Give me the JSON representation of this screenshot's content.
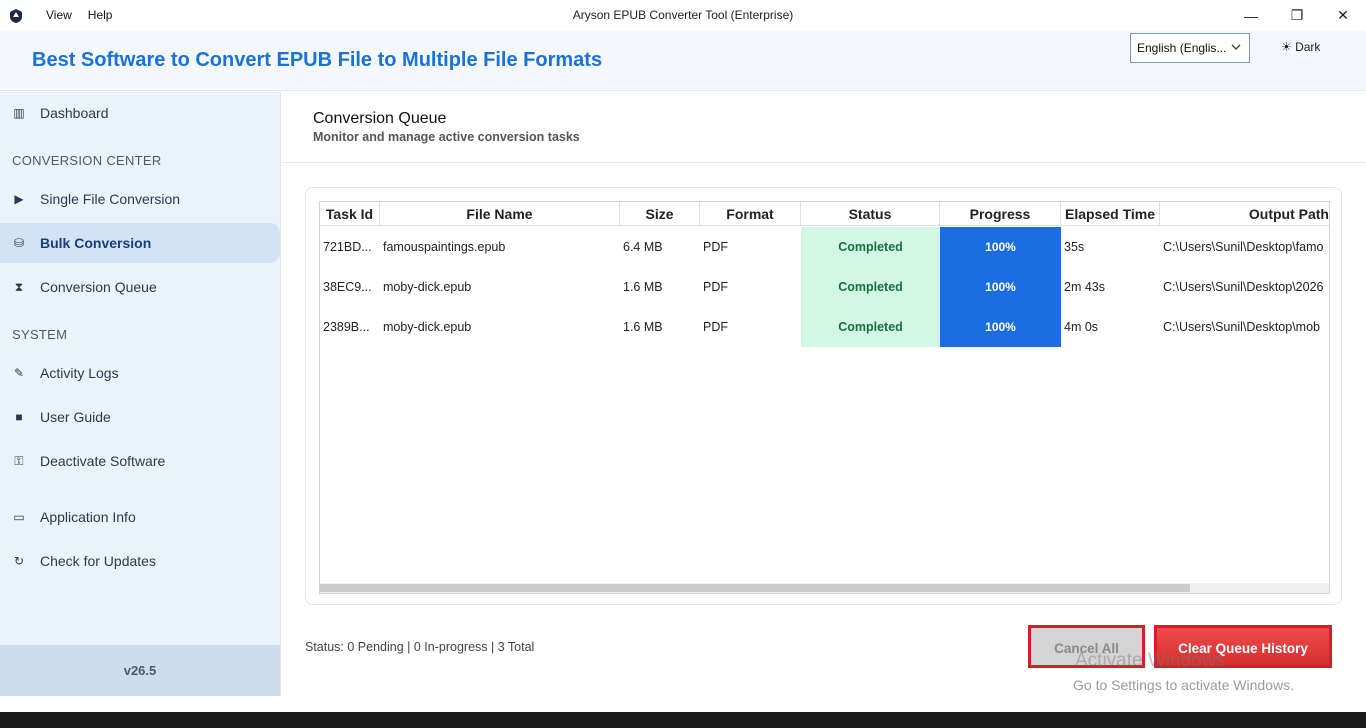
{
  "window": {
    "title": "Aryson EPUB Converter Tool (Enterprise)",
    "menu": [
      "View",
      "Help"
    ],
    "minimize": "—",
    "maximize": "❐",
    "close": "✕"
  },
  "header": {
    "title": "Best Software to Convert EPUB File to Multiple File Formats",
    "language": "English (Englis...",
    "theme_toggle": "☀ Dark"
  },
  "sidebar": {
    "dashboard": "Dashboard",
    "section_conversion": "CONVERSION CENTER",
    "single": "Single File Conversion",
    "bulk": "Bulk Conversion",
    "queue": "Conversion Queue",
    "section_system": "SYSTEM",
    "logs": "Activity Logs",
    "guide": "User Guide",
    "deactivate": "Deactivate Software",
    "info": "Application Info",
    "updates": "Check for Updates",
    "version": "v26.5"
  },
  "main": {
    "title": "Conversion Queue",
    "subtitle": "Monitor and manage active conversion tasks",
    "columns": [
      "Task Id",
      "File Name",
      "Size",
      "Format",
      "Status",
      "Progress",
      "Elapsed Time",
      "Output Path"
    ],
    "rows": [
      {
        "id": "721BD...",
        "file": "famouspaintings.epub",
        "size": "6.4 MB",
        "format": "PDF",
        "status": "Completed",
        "progress": "100%",
        "elapsed": "35s",
        "path": "C:\\Users\\Sunil\\Desktop\\famo"
      },
      {
        "id": "38EC9...",
        "file": "moby-dick.epub",
        "size": "1.6 MB",
        "format": "PDF",
        "status": "Completed",
        "progress": "100%",
        "elapsed": "2m 43s",
        "path": "C:\\Users\\Sunil\\Desktop\\2026"
      },
      {
        "id": "2389B...",
        "file": "moby-dick.epub",
        "size": "1.6 MB",
        "format": "PDF",
        "status": "Completed",
        "progress": "100%",
        "elapsed": "4m 0s",
        "path": "C:\\Users\\Sunil\\Desktop\\mob"
      }
    ],
    "status_text": "Status: 0 Pending | 0 In-progress | 3 Total",
    "cancel_all": "Cancel All",
    "clear_history": "Clear Queue History"
  },
  "watermark": {
    "title": "Activate Windows",
    "subtitle": "Go to Settings to activate Windows."
  },
  "colors": {
    "accent": "#1a72d8",
    "progress": "#1a6ee0",
    "status_bg": "#d2f7e3",
    "danger": "#d0202a"
  }
}
